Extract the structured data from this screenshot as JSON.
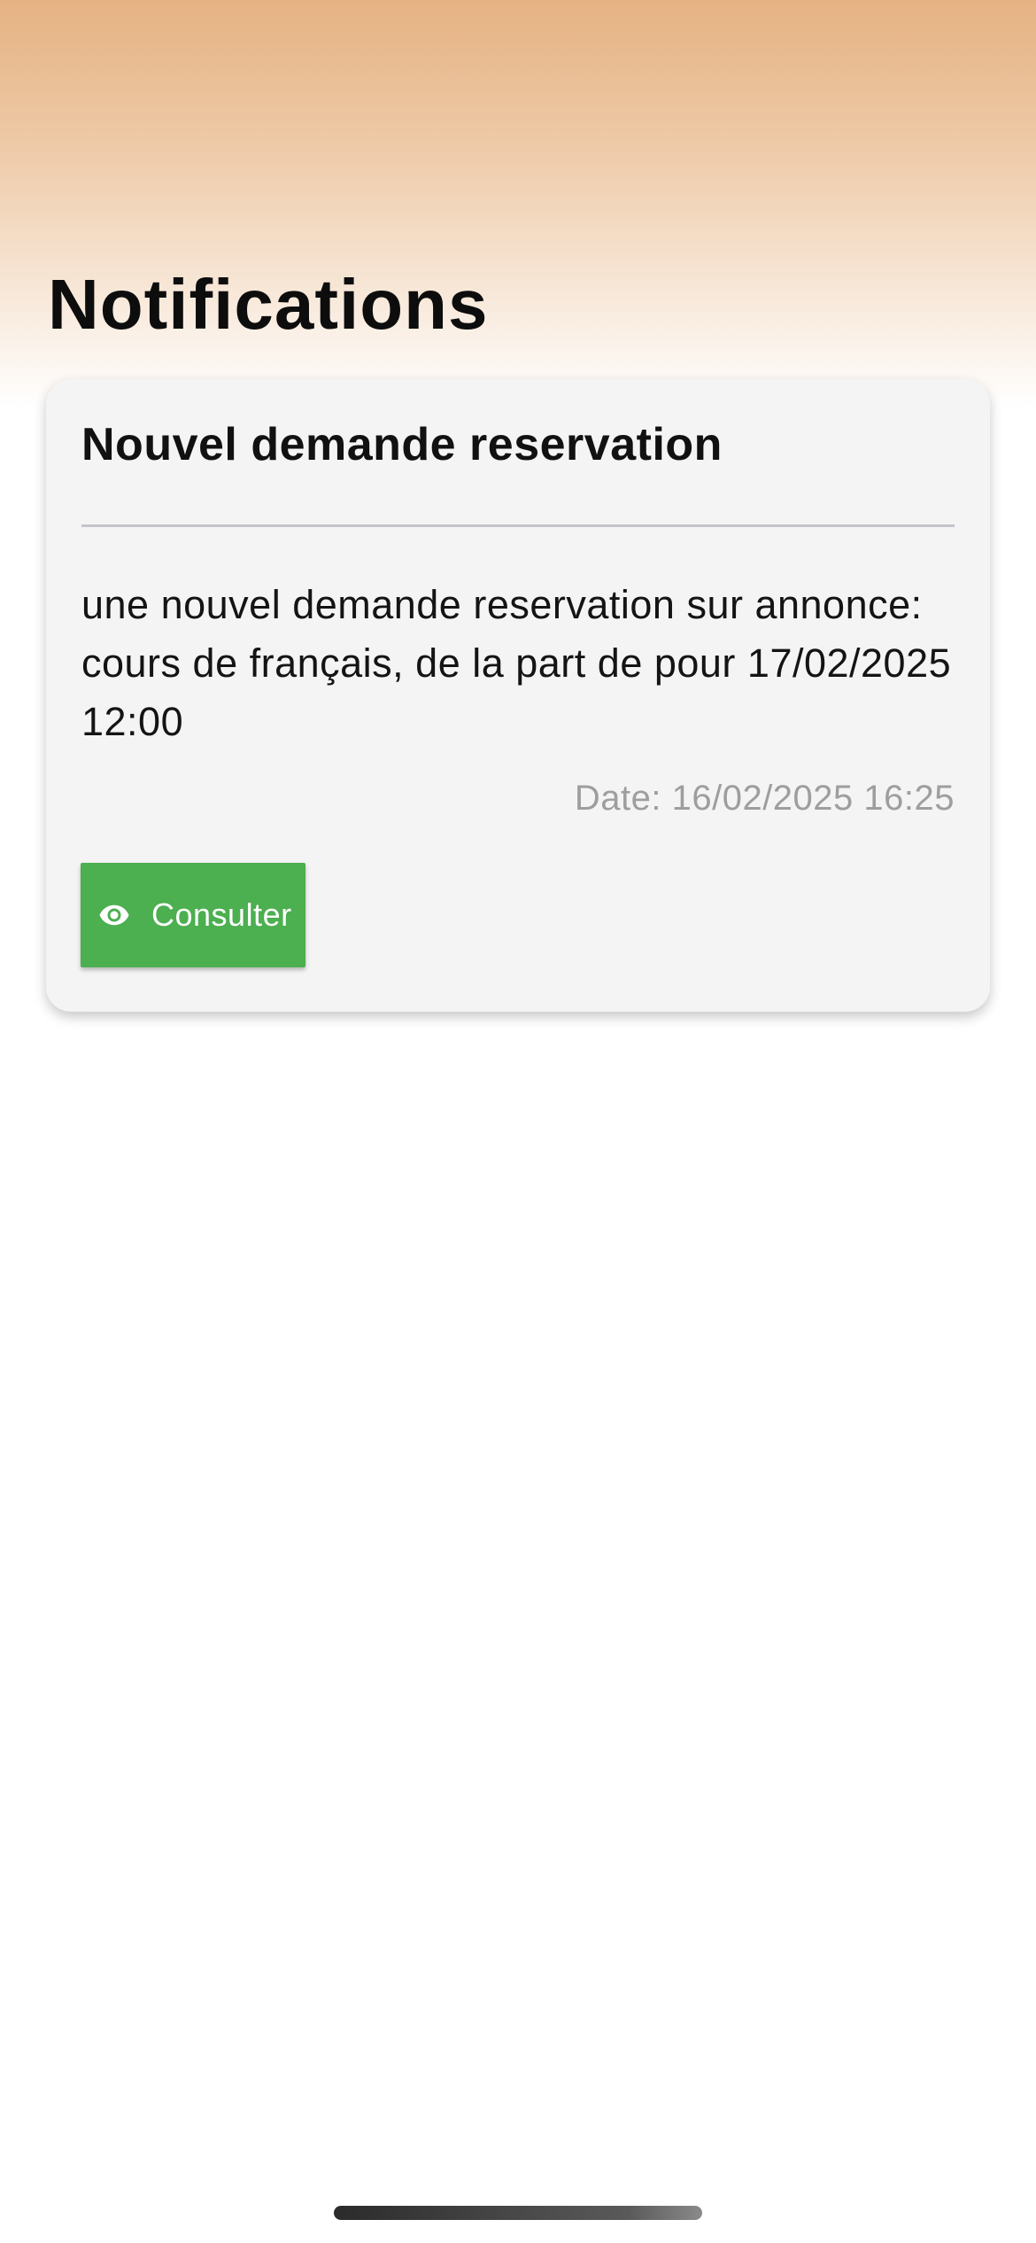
{
  "page": {
    "title": "Notifications"
  },
  "notifications": [
    {
      "title": "Nouvel demande reservation",
      "message": "une nouvel demande reservation sur annonce: cours de français, de la part de  pour 17/02/2025 12:00",
      "date": "Date: 16/02/2025 16:25",
      "action_label": "Consulter",
      "action_icon": "eye-icon"
    }
  ],
  "colors": {
    "header_gradient_top": "#e5b283",
    "card_background": "#f4f4f4",
    "button_green": "#4caf50",
    "date_text": "#9e9e9e"
  }
}
